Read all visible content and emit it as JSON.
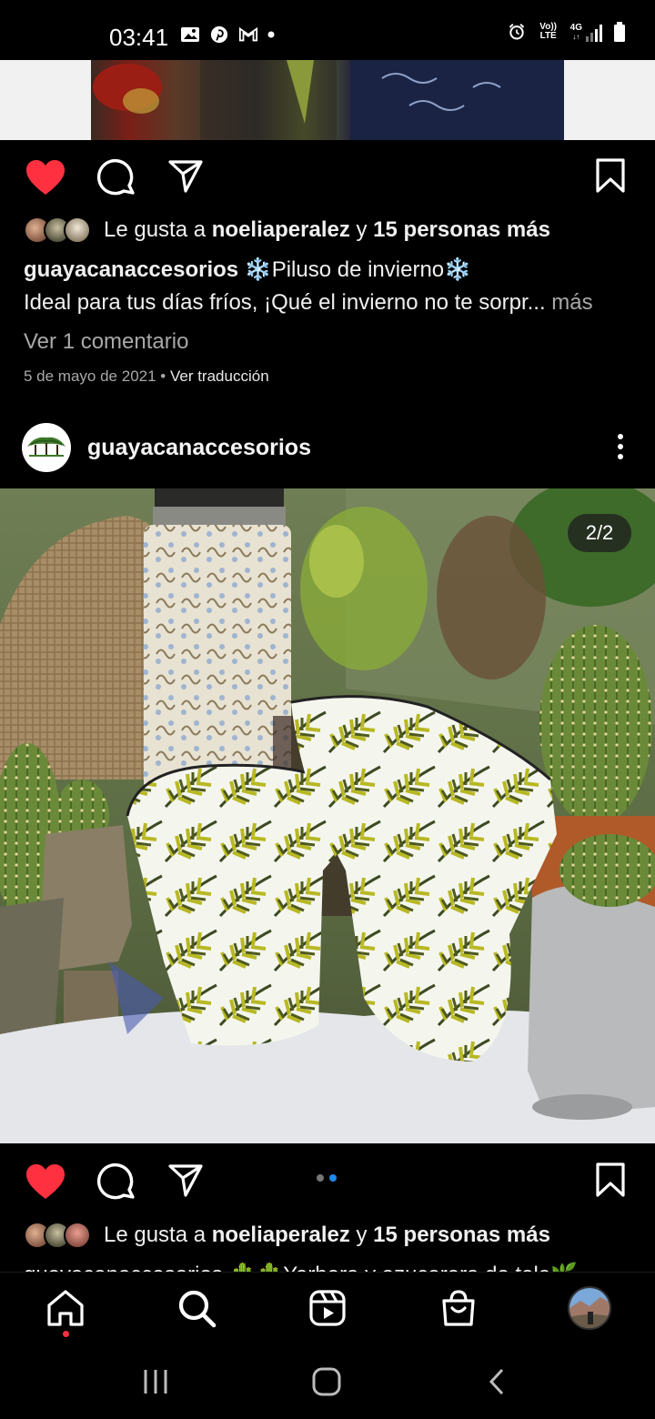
{
  "status_bar": {
    "time": "03:41",
    "left_icons": [
      "gallery-icon",
      "pinterest-icon",
      "gmail-icon",
      "dot-icon"
    ],
    "network_top": "Vo))",
    "network_bottom": "LTE",
    "signal_label": "4G",
    "right_icons": [
      "alarm-icon",
      "volte-icon",
      "signal-icon",
      "battery-icon"
    ]
  },
  "post1": {
    "likes": {
      "prefix": "Le gusta a ",
      "user": "noeliaperalez",
      "middle": " y ",
      "others": "15 personas más"
    },
    "caption": {
      "username": "guayacanaccesorios",
      "title": " ❄️Piluso de invierno❄️",
      "body": "Ideal para tus días fríos, ¡Qué el invierno no te sorpr...",
      "more": " más"
    },
    "comments_link": "Ver 1 comentario",
    "date": "5 de mayo de 2021",
    "separator": " • ",
    "translate": "Ver traducción"
  },
  "post2": {
    "username": "guayacanaccesorios",
    "counter": "2/2",
    "slide_index": 2,
    "slide_total": 2,
    "likes": {
      "prefix": "Le gusta a ",
      "user": "noeliaperalez",
      "middle": " y ",
      "others": "15 personas más"
    },
    "caption_partial": "guayacanaccesorios 🌵🌵Yerbera y azucarera de tela🌿"
  },
  "colors": {
    "like_red": "#ff3040",
    "active_dot": "#1d8bf1",
    "background": "#000000"
  },
  "bottom_nav": [
    "home-icon",
    "search-icon",
    "reels-icon",
    "shop-icon",
    "profile-avatar"
  ]
}
